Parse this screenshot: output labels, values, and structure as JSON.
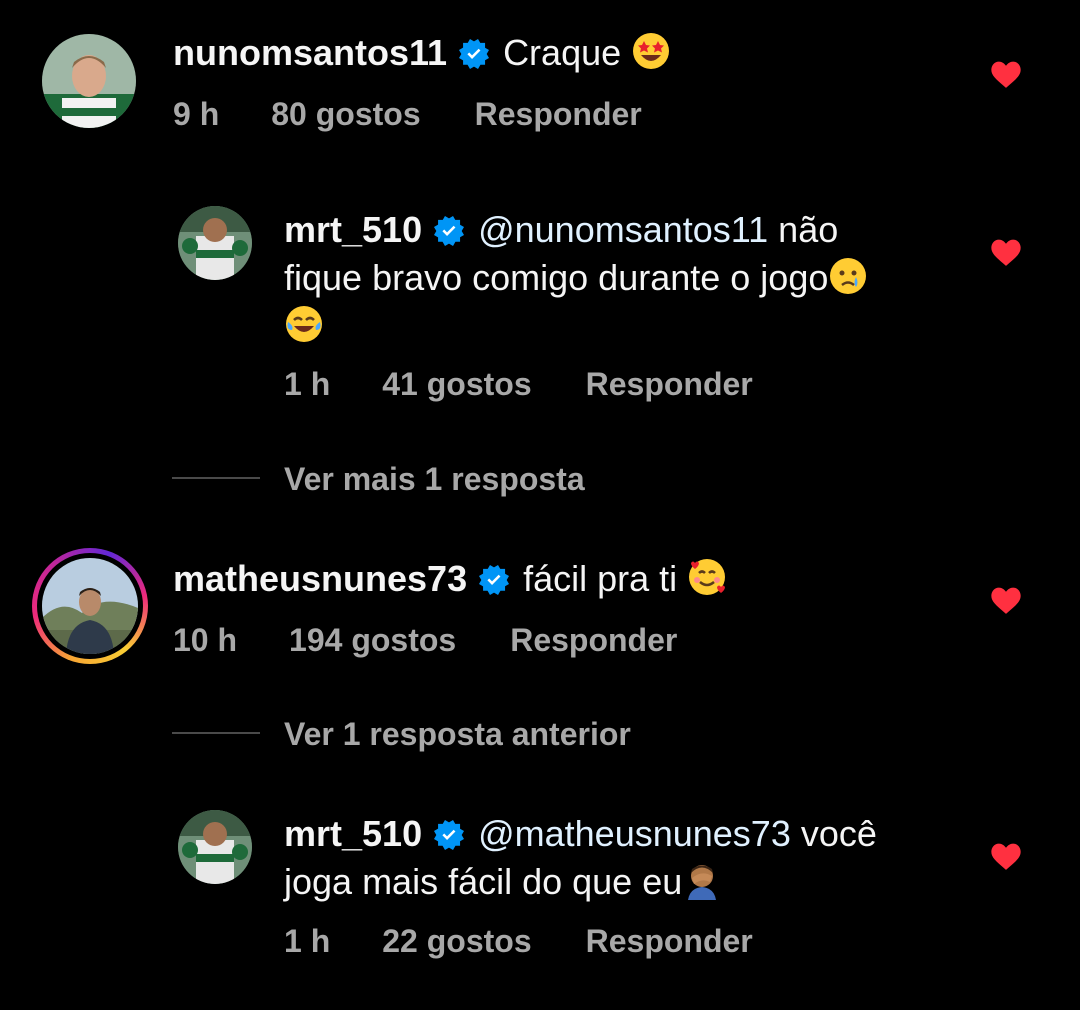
{
  "comments": [
    {
      "username": "nunomsantos11",
      "text": "Craque",
      "emoji": "star-struck-emoji",
      "time": "9 h",
      "likes": "80 gostos",
      "reply_label": "Responder",
      "liked": true
    },
    {
      "username": "mrt_510",
      "mention": "@nunomsantos11",
      "text_line1": "não",
      "text_line2": "fique bravo comigo durante o jogo",
      "emoji_line2": "crying-face-emoji",
      "emoji_line3": "tears-of-joy-emoji",
      "time": "1 h",
      "likes": "41 gostos",
      "reply_label": "Responder",
      "liked": true
    },
    {
      "view_more": "Ver mais 1 resposta"
    },
    {
      "username": "matheusnunes73",
      "text": "fácil pra ti",
      "emoji": "smiling-face-with-hearts-emoji",
      "time": "10 h",
      "likes": "194 gostos",
      "reply_label": "Responder",
      "liked": true
    },
    {
      "view_previous": "Ver 1 resposta anterior"
    },
    {
      "username": "mrt_510",
      "mention": "@matheusnunes73",
      "text_line1": "você",
      "text_line2": "joga mais fácil do que eu",
      "emoji_line2": "man-facepalming-emoji",
      "time": "1 h",
      "likes": "22 gostos",
      "reply_label": "Responder",
      "liked": true
    }
  ],
  "colors": {
    "background": "#000000",
    "text": "#f5f5f5",
    "meta": "#a8a8a8",
    "mention": "#e0f1ff",
    "heart": "#ff3040",
    "verified": "#0095f6"
  }
}
